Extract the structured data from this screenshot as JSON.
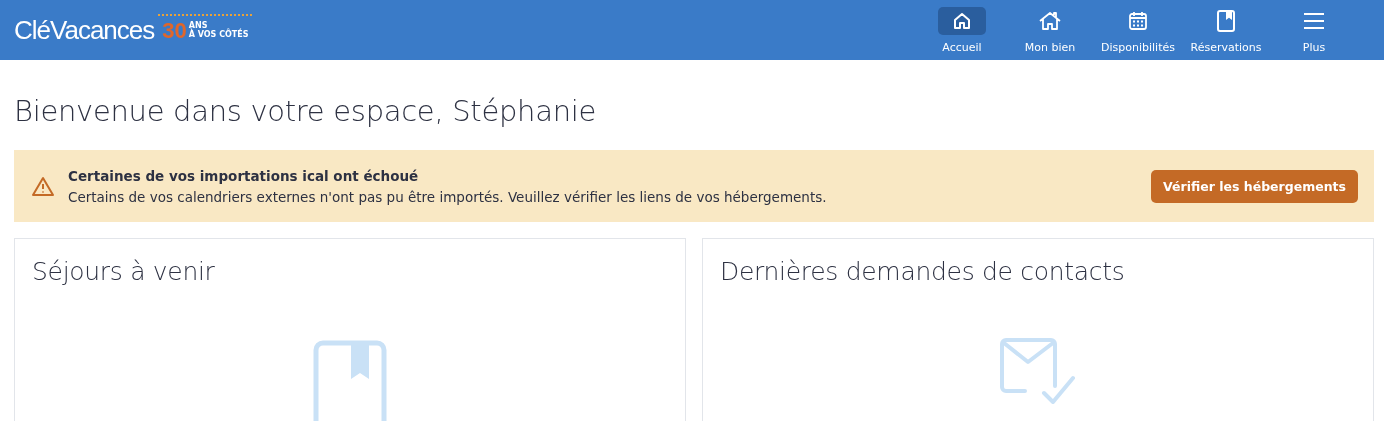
{
  "header": {
    "logo": {
      "text": "CléVacances",
      "badge_number": "30",
      "badge_unit": "ANS",
      "badge_tagline": "À VOS CÔTÉS"
    },
    "nav": [
      {
        "kind": "home",
        "label": "Accueil",
        "selected": true
      },
      {
        "kind": "house",
        "label": "Mon bien",
        "selected": false
      },
      {
        "kind": "calendar",
        "label": "Disponibilités",
        "selected": false
      },
      {
        "kind": "book",
        "label": "Réservations",
        "selected": false
      },
      {
        "kind": "menu",
        "label": "Plus",
        "selected": false
      }
    ]
  },
  "page_title": "Bienvenue dans votre espace, Stéphanie",
  "alert": {
    "title": "Certaines de vos importations ical ont échoué",
    "message": "Certains de vos calendriers externes n'ont pas pu être importés. Veuillez vérifier les liens de vos hébergements.",
    "button": "Vérifier les hébergements"
  },
  "cards": [
    {
      "kind": "book",
      "title": "Séjours à venir"
    },
    {
      "kind": "mail",
      "title": "Dernières demandes de contacts"
    }
  ]
}
